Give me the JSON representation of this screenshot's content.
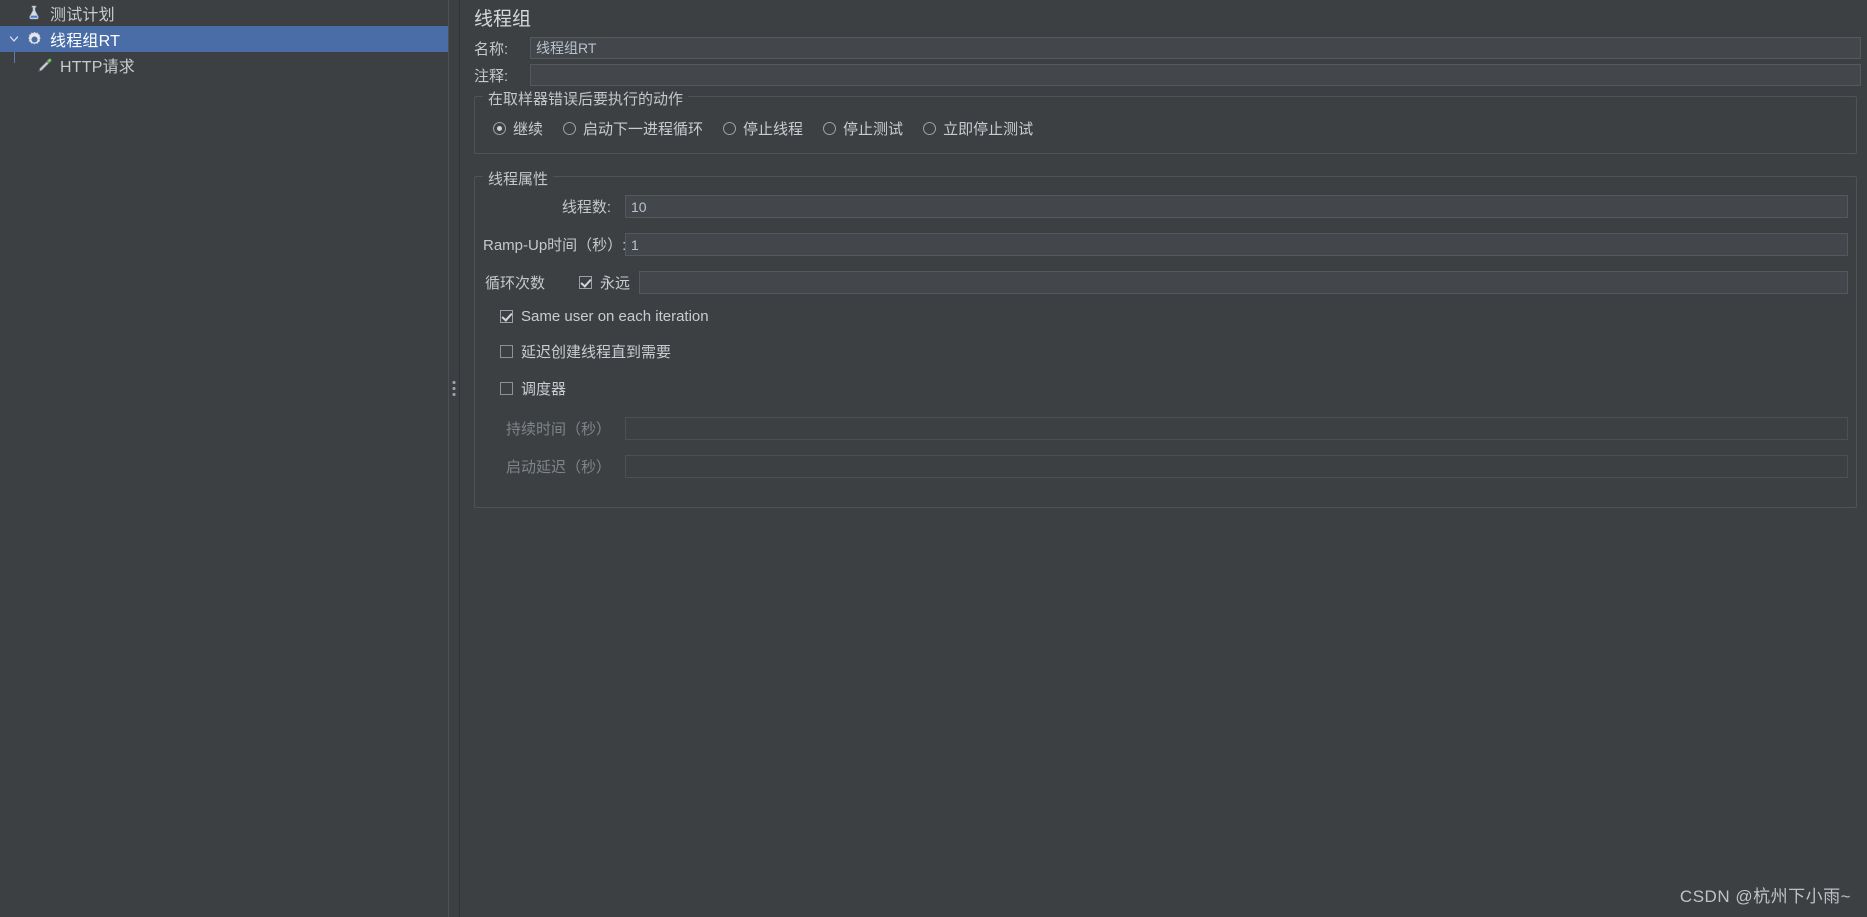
{
  "tree": {
    "nodes": [
      {
        "label": "测试计划",
        "icon": "test-plan-icon",
        "depth": 1,
        "selected": false,
        "twisty": "none"
      },
      {
        "label": "线程组RT",
        "icon": "thread-group-icon",
        "depth": 2,
        "selected": true,
        "twisty": "expanded"
      },
      {
        "label": "HTTP请求",
        "icon": "http-request-icon",
        "depth": 3,
        "selected": false,
        "twisty": "none"
      }
    ],
    "selection_color": "#4a6da7"
  },
  "main": {
    "title": "线程组",
    "name_field": {
      "label": "名称:",
      "value": "线程组RT"
    },
    "comment_field": {
      "label": "注释:",
      "value": "",
      "placeholder": ""
    },
    "error_action": {
      "group_title": "在取样器错误后要执行的动作",
      "options": [
        {
          "label": "继续",
          "checked": true
        },
        {
          "label": "启动下一进程循环",
          "checked": false
        },
        {
          "label": "停止线程",
          "checked": false
        },
        {
          "label": "停止测试",
          "checked": false
        },
        {
          "label": "立即停止测试",
          "checked": false
        }
      ]
    },
    "thread_properties": {
      "group_title": "线程属性",
      "thread_count": {
        "label": "线程数:",
        "value": "10"
      },
      "ramp_up": {
        "label": "Ramp-Up时间（秒）:",
        "value": "1"
      },
      "loop_count": {
        "label": "循环次数",
        "forever_label": "永远",
        "forever_checked": true,
        "value": ""
      },
      "same_user": {
        "label": "Same user on each iteration",
        "checked": true
      },
      "delay_thread_creation": {
        "label": "延迟创建线程直到需要",
        "checked": false
      },
      "scheduler": {
        "label": "调度器",
        "checked": false
      },
      "duration": {
        "label": "持续时间（秒）",
        "value": "",
        "disabled": true
      },
      "startup_delay": {
        "label": "启动延迟（秒）",
        "value": "",
        "disabled": true
      }
    }
  },
  "watermark": {
    "text": "CSDN @杭州下小雨~"
  }
}
